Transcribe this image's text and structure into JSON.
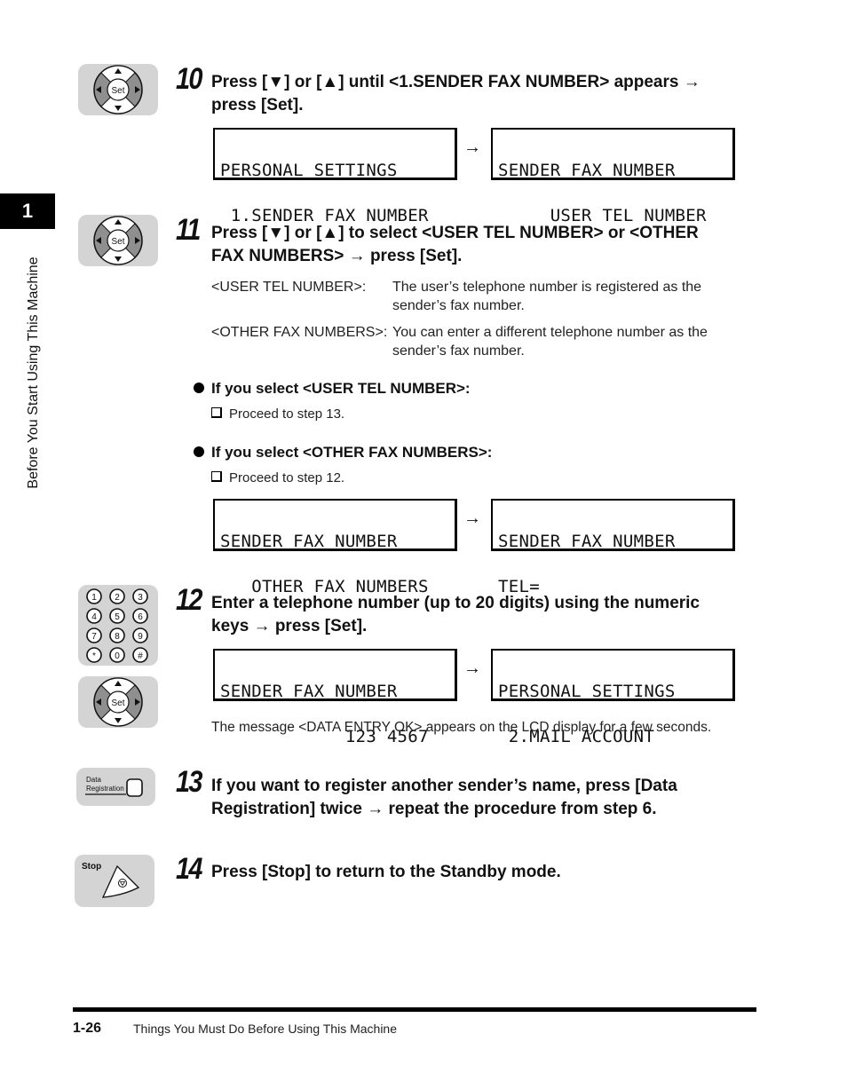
{
  "sidebar": {
    "chapter_number": "1",
    "chapter_title": "Before You Start Using This Machine"
  },
  "icons": {
    "dpad_center_label": "Set",
    "keypad_keys": [
      "1",
      "2",
      "3",
      "4",
      "5",
      "6",
      "7",
      "8",
      "9",
      "*",
      "0",
      "#"
    ],
    "data_registration_label_line1": "Data",
    "data_registration_label_line2": "Registration",
    "stop_label": "Stop"
  },
  "arrow": "→",
  "steps": [
    {
      "number": "10",
      "heading_line1": "Press [▼] or [▲] until <1.SENDER FAX NUMBER> appears →",
      "heading_line2": "press [Set].",
      "lcd_before": [
        "PERSONAL SETTINGS",
        " 1.SENDER FAX NUMBER"
      ],
      "lcd_after": [
        "SENDER FAX NUMBER",
        "     USER TEL NUMBER"
      ]
    },
    {
      "number": "11",
      "heading_line1": "Press [▼] or [▲] to select <USER TEL NUMBER> or <OTHER",
      "heading_line2": "FAX NUMBERS> → press [Set].",
      "options": [
        {
          "term": "<USER TEL NUMBER>:",
          "desc_line1": "The user’s telephone number is registered as the",
          "desc_line2": "sender’s fax number."
        },
        {
          "term": "<OTHER FAX NUMBERS>:",
          "desc_line1": "You can enter a different telephone number as the",
          "desc_line2": "sender’s fax number."
        }
      ],
      "branches": [
        {
          "heading": "If you select <USER TEL NUMBER>:",
          "action": "Proceed to step 13."
        },
        {
          "heading": "If you select <OTHER FAX NUMBERS>:",
          "action": "Proceed to step 12."
        }
      ],
      "lcd_before": [
        "SENDER FAX NUMBER",
        "   OTHER FAX NUMBERS"
      ],
      "lcd_after": [
        "SENDER FAX NUMBER",
        "TEL="
      ]
    },
    {
      "number": "12",
      "heading_line1": "Enter a telephone number (up to 20 digits) using the numeric",
      "heading_line2": "keys → press [Set].",
      "lcd_before": [
        "SENDER FAX NUMBER",
        "            123 4567"
      ],
      "lcd_after": [
        "PERSONAL SETTINGS",
        " 2.MAIL ACCOUNT"
      ],
      "note": "The message <DATA ENTRY OK> appears on the LCD display for a few seconds."
    },
    {
      "number": "13",
      "heading_line1": "If you want to register another sender’s name, press [Data",
      "heading_line2": "Registration] twice → repeat the procedure from step 6."
    },
    {
      "number": "14",
      "heading_line1": "Press [Stop] to return to the Standby mode."
    }
  ],
  "footer": {
    "page_number": "1-26",
    "section_title": "Things You Must Do Before Using This Machine"
  }
}
